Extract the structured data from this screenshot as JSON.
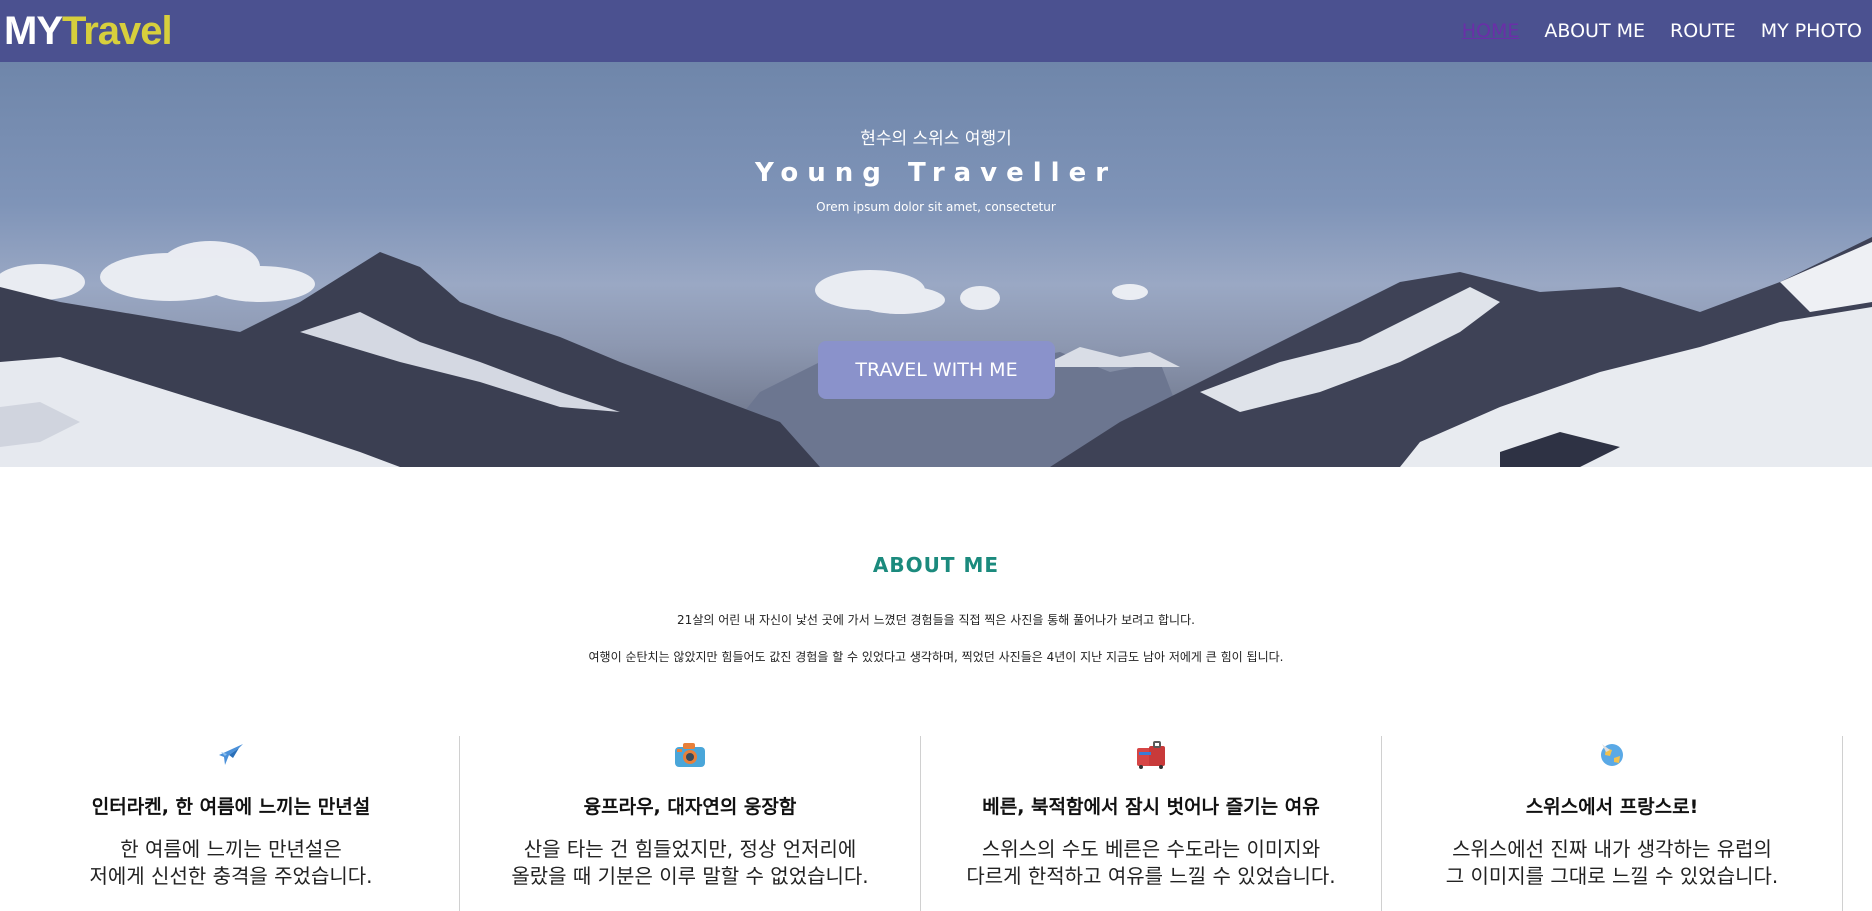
{
  "brand": {
    "logo_part1": "MY",
    "logo_part2": "Travel"
  },
  "nav": {
    "items": [
      "HOME",
      "ABOUT ME",
      "ROUTE",
      "MY PHOTO"
    ],
    "active": "HOME"
  },
  "hero": {
    "subtitle": "현수의 스위스 여행기",
    "title": "Young Traveller",
    "description": "Orem ipsum dolor sit amet, consectetur",
    "button_label": "TRAVEL WITH ME"
  },
  "about": {
    "title": "ABOUT ME",
    "paragraph1": "21살의 어린 내 자신이 낯선 곳에 가서 느꼈던 경험들을 직접 찍은 사진을 통해 풀어나가 보려고 합니다.",
    "paragraph2": "여행이 순탄치는 않았지만 힘들어도 값진 경험을 할 수 있었다고 생각하며, 찍었던 사진들은 4년이 지난 지금도 남아 저에게 큰 힘이 됩니다."
  },
  "features": [
    {
      "icon": "airplane-icon",
      "title": "인터라켄, 한 여름에 느끼는 만년설",
      "line1": "한 여름에 느끼는 만년설은",
      "line2": "저에게 신선한 충격을 주었습니다."
    },
    {
      "icon": "camera-icon",
      "title": "융프라우, 대자연의 웅장함",
      "line1": "산을 타는 건 힘들었지만, 정상 언저리에",
      "line2": "올랐을 때 기분은 이루 말할 수 없었습니다."
    },
    {
      "icon": "luggage-icon",
      "title": "베른, 북적함에서 잠시 벗어나 즐기는 여유",
      "line1": "스위스의 수도 베른은 수도라는 이미지와",
      "line2": "다르게 한적하고 여유를 느낄 수 있었습니다."
    },
    {
      "icon": "globe-icon",
      "title": "스위스에서 프랑스로!",
      "line1": "스위스에선 진짜 내가 생각하는 유럽의",
      "line2": "그 이미지를 그대로 느낄 수 있었습니다."
    }
  ],
  "colors": {
    "navbar": "#4b5190",
    "logo_accent": "#d7cf3c",
    "nav_active": "#6a2fa8",
    "about_title": "#1b8a7d",
    "hero_button": "#8a92cb"
  }
}
